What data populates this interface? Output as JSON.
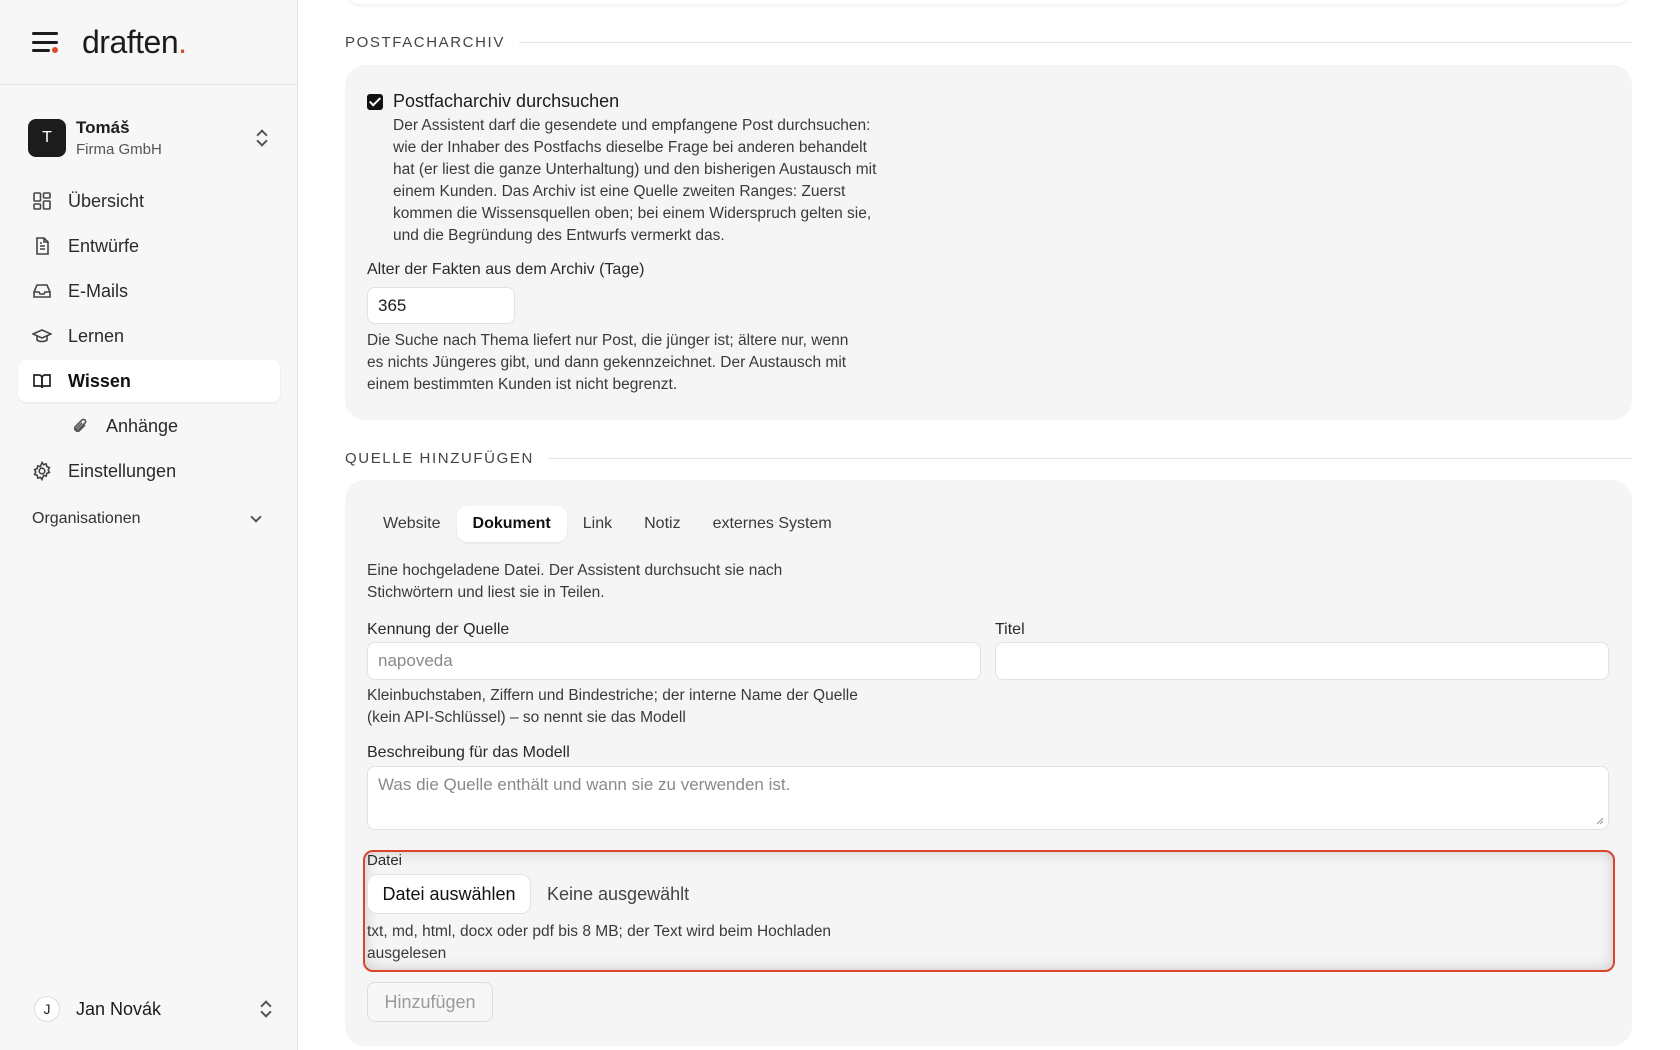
{
  "app": {
    "logo_text": "draften",
    "logo_dot": ".",
    "accent_color": "#e04a2a"
  },
  "org": {
    "avatar_letter": "T",
    "name": "Tomáš",
    "company": "Firma GmbH"
  },
  "nav": {
    "items": [
      {
        "label": "Übersicht",
        "icon": "dashboard-icon"
      },
      {
        "label": "Entwürfe",
        "icon": "document-icon"
      },
      {
        "label": "E-Mails",
        "icon": "inbox-icon"
      },
      {
        "label": "Lernen",
        "icon": "graduation-cap-icon"
      },
      {
        "label": "Wissen",
        "icon": "book-icon",
        "active": true
      },
      {
        "label": "Anhänge",
        "icon": "paperclip-icon",
        "sub": true
      },
      {
        "label": "Einstellungen",
        "icon": "gear-icon"
      }
    ],
    "section_label": "Organisationen"
  },
  "user": {
    "avatar_letter": "J",
    "name": "Jan Novák"
  },
  "archive": {
    "section_title": "POSTFACHARCHIV",
    "checkbox_label": "Postfacharchiv durchsuchen",
    "checkbox_checked": true,
    "description_lines": [
      "Der Assistent darf die gesendete und empfangene Post durchsuchen:",
      "wie der Inhaber des Postfachs dieselbe Frage bei anderen behandelt",
      "hat (er liest die ganze Unterhaltung) und den bisherigen Austausch mit",
      "einem Kunden. Das Archiv ist eine Quelle zweiten Ranges: Zuerst",
      "kommen die Wissensquellen oben; bei einem Widerspruch gelten sie,",
      "und die Begründung des Entwurfs vermerkt das."
    ],
    "age_label": "Alter der Fakten aus dem Archiv (Tage)",
    "age_value": "365",
    "age_help_lines": [
      "Die Suche nach Thema liefert nur Post, die jünger ist; ältere nur, wenn",
      "es nichts Jüngeres gibt, und dann gekennzeichnet. Der Austausch mit",
      "einem bestimmten Kunden ist nicht begrenzt."
    ]
  },
  "add_source": {
    "section_title": "QUELLE HINZUFÜGEN",
    "tabs": [
      "Website",
      "Dokument",
      "Link",
      "Notiz",
      "externes System"
    ],
    "active_tab": "Dokument",
    "intro_lines": [
      "Eine hochgeladene Datei. Der Assistent durchsucht sie nach",
      "Stichwörtern und liest sie in Teilen."
    ],
    "id_label": "Kennung der Quelle",
    "id_placeholder": "napoveda",
    "title_label": "Titel",
    "title_value": "",
    "id_help_lines": [
      "Kleinbuchstaben, Ziffern und Bindestriche; der interne Name der Quelle",
      "(kein API-Schlüssel) – so nennt sie das Modell"
    ],
    "desc_label": "Beschreibung für das Modell",
    "desc_placeholder": "Was die Quelle enthält und wann sie zu verwenden ist.",
    "file_label": "Datei",
    "file_button": "Datei auswählen",
    "file_status": "Keine ausgewählt",
    "file_help_lines": [
      "txt, md, html, docx oder pdf bis 8 MB; der Text wird beim Hochladen",
      "ausgelesen"
    ],
    "submit_label": "Hinzufügen",
    "highlight_color": "#d9442e"
  }
}
